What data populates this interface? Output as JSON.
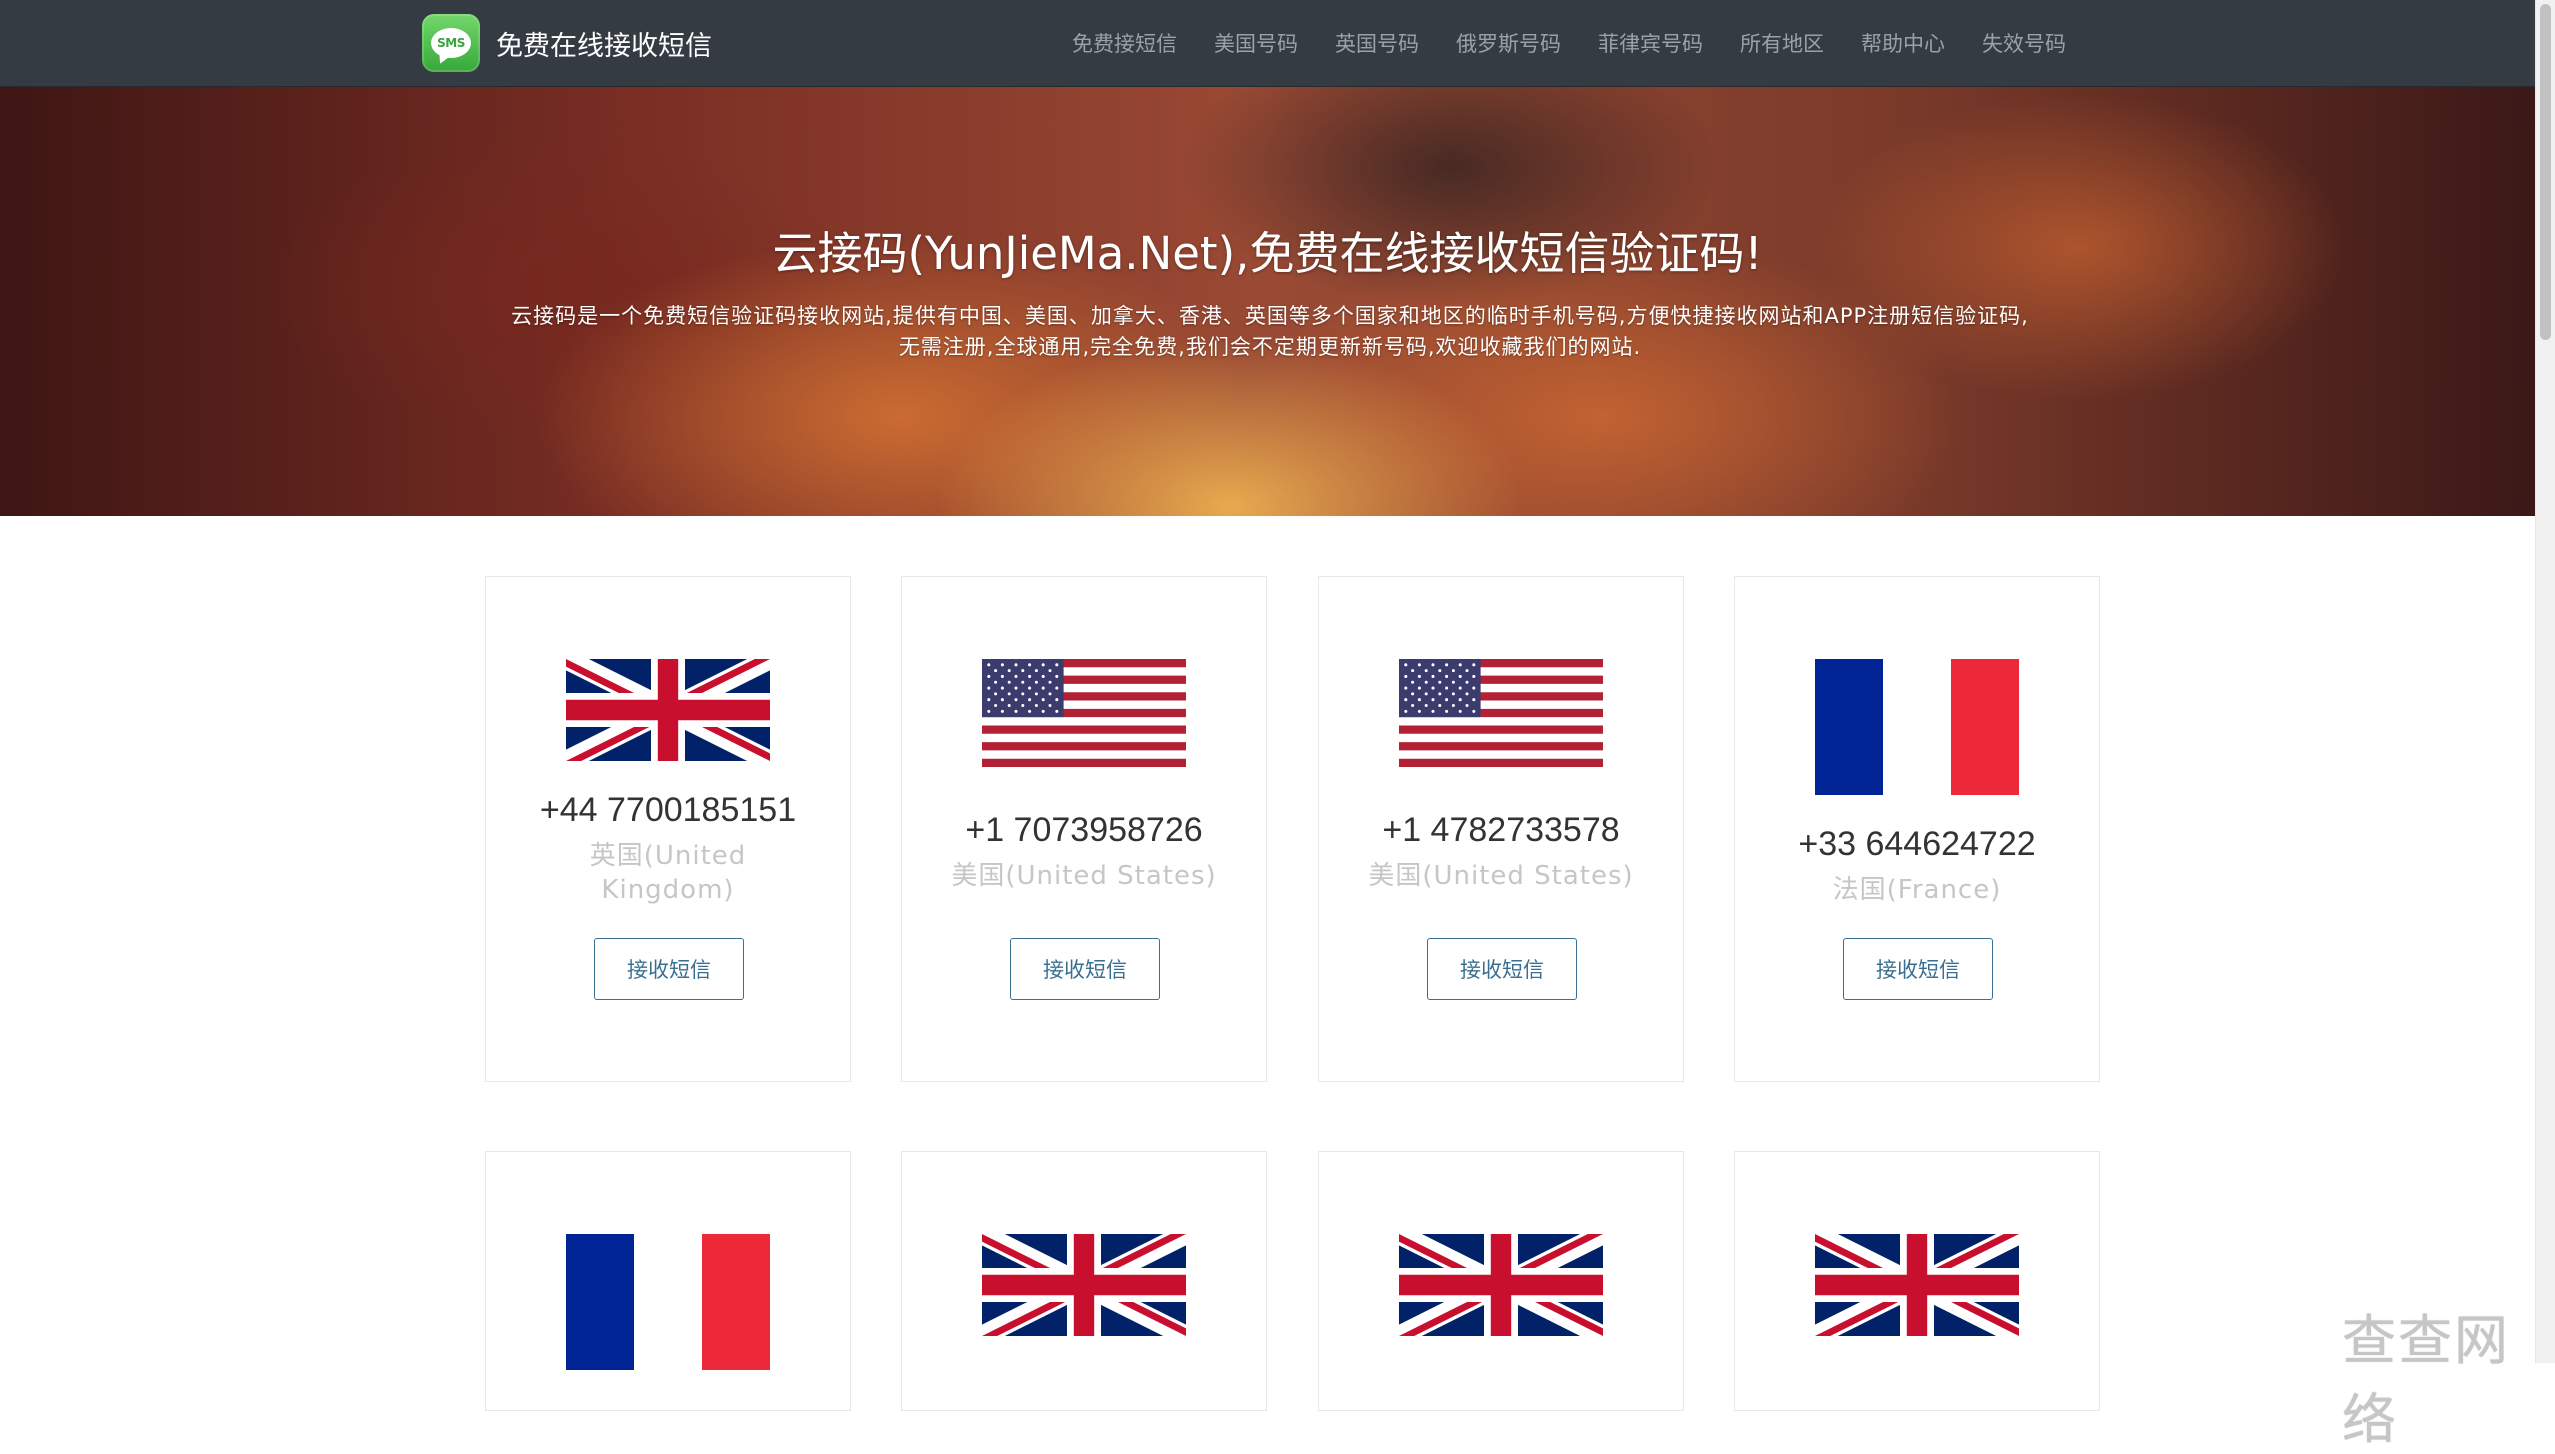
{
  "navbar": {
    "brand_logo_text": "SMS",
    "brand": "免费在线接收短信",
    "links": [
      "免费接短信",
      "美国号码",
      "英国号码",
      "俄罗斯号码",
      "菲律宾号码",
      "所有地区",
      "帮助中心",
      "失效号码"
    ]
  },
  "hero": {
    "title": "云接码(YunJieMa.Net),免费在线接收短信验证码!",
    "desc_line1": "云接码是一个免费短信验证码接收网站,提供有中国、美国、加拿大、香港、英国等多个国家和地区的临时手机号码,方便快捷接收网站和APP注册短信验证码,",
    "desc_line2": "无需注册,全球通用,完全免费,我们会不定期更新新号码,欢迎收藏我们的网站."
  },
  "cards": [
    {
      "flag": "uk-flag-icon",
      "phone": "+44 7700185151",
      "country_line1": "英国(United",
      "country_line2": "Kingdom)",
      "button": "接收短信"
    },
    {
      "flag": "us-flag-icon",
      "phone": "+1 7073958726",
      "country_line1": "美国(United States)",
      "country_line2": "",
      "button": "接收短信"
    },
    {
      "flag": "us-flag-icon",
      "phone": "+1 4782733578",
      "country_line1": "美国(United States)",
      "country_line2": "",
      "button": "接收短信"
    },
    {
      "flag": "france-flag-icon",
      "phone": "+33 644624722",
      "country_line1": "法国(France)",
      "country_line2": "",
      "button": "接收短信"
    },
    {
      "flag": "france-flag-icon"
    },
    {
      "flag": "uk-flag-icon"
    },
    {
      "flag": "uk-flag-icon"
    },
    {
      "flag": "uk-flag-icon"
    }
  ],
  "watermark": "查查网络",
  "colors": {
    "navbar_bg": "#353b42",
    "nav_link": "#9aa1a8",
    "button_border": "#3a6f91",
    "country_text": "#c6c6c6",
    "flag_red": "#c8102e",
    "flag_blue": "#012169",
    "fr_blue": "#002395",
    "fr_red": "#ed2939"
  }
}
